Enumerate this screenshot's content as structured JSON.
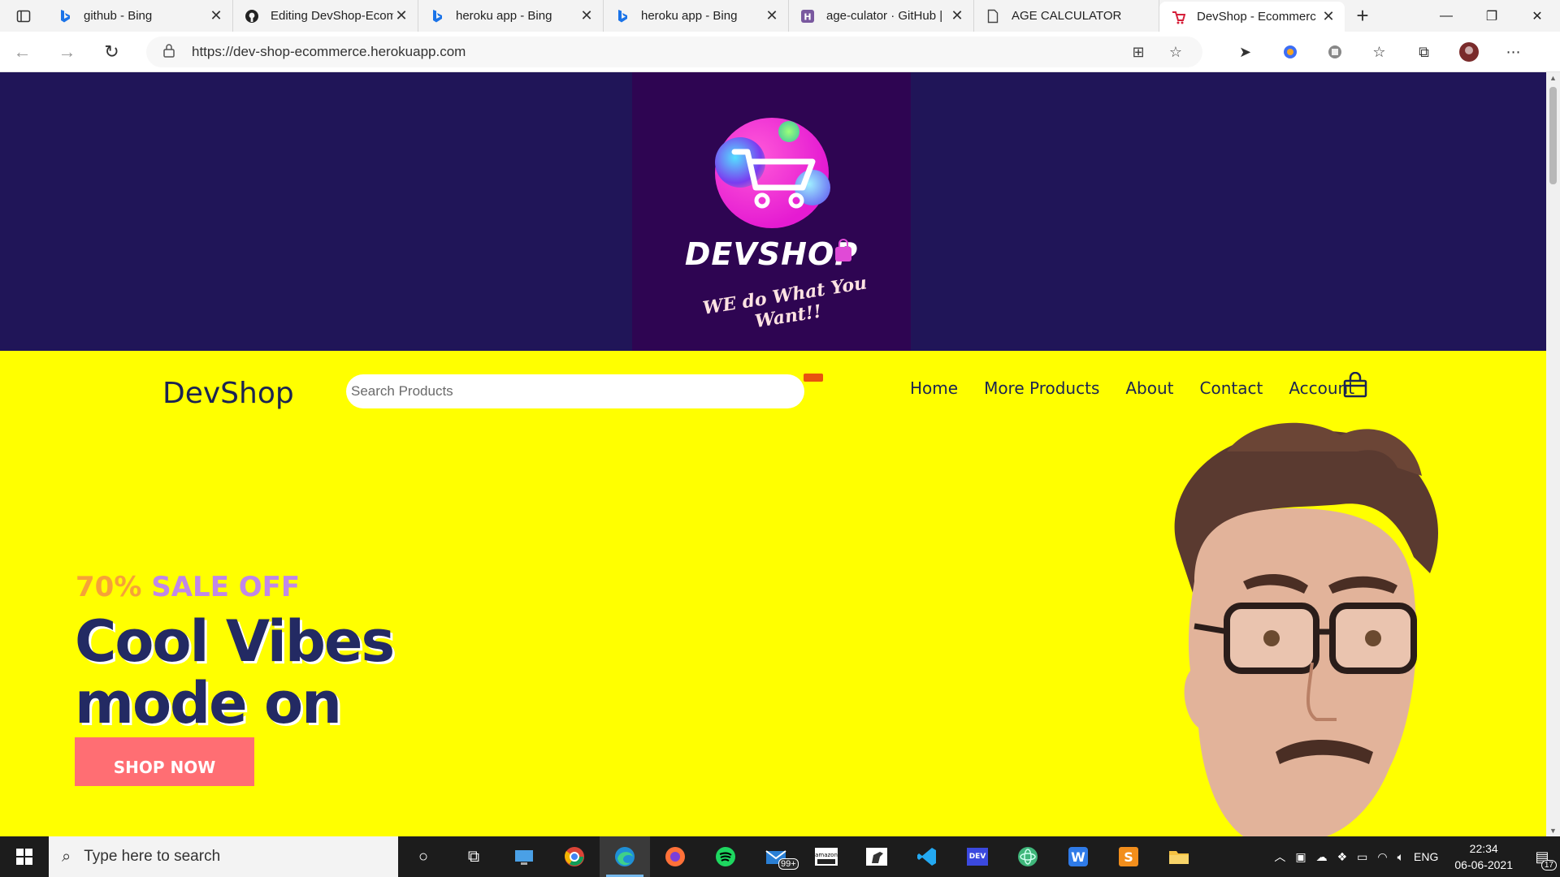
{
  "browser": {
    "tabs": [
      {
        "title": "github - Bing",
        "icon": "bing-icon"
      },
      {
        "title": "Editing DevShop-Ecom",
        "icon": "github-icon"
      },
      {
        "title": "heroku app - Bing",
        "icon": "bing-icon"
      },
      {
        "title": "heroku app - Bing",
        "icon": "bing-icon"
      },
      {
        "title": "age-culator · GitHub |",
        "icon": "heroku-icon"
      },
      {
        "title": "AGE CALCULATOR",
        "icon": "page-icon"
      },
      {
        "title": "DevShop - Ecommerc",
        "icon": "devshop-icon"
      }
    ],
    "url": "https://dev-shop-ecommerce.herokuapp.com"
  },
  "banner": {
    "logo_title": "DEVSHOP",
    "logo_tagline": "WE do What You Want!!"
  },
  "header": {
    "brand": "DevShop",
    "search_placeholder": "Search Products",
    "nav": [
      "Home",
      "More Products",
      "About",
      "Contact",
      "Account"
    ]
  },
  "hero": {
    "sale_pct": "70%",
    "sale_rest": "SALE OFF",
    "headline_line1": "Cool Vibes",
    "headline_line2": "mode on",
    "cta": "SHOP NOW"
  },
  "taskbar": {
    "search_placeholder": "Type here to search",
    "mail_badge": "99+",
    "language": "ENG",
    "time": "22:34",
    "date": "06-06-2021",
    "notification_count": "17"
  },
  "colors": {
    "banner_bg": "#201558",
    "hero_bg": "#ffff00",
    "brand_text": "#1b2452",
    "sale_pct": "#f6a238",
    "sale_rest": "#c088e8",
    "cta_bg": "#ff6e73"
  }
}
